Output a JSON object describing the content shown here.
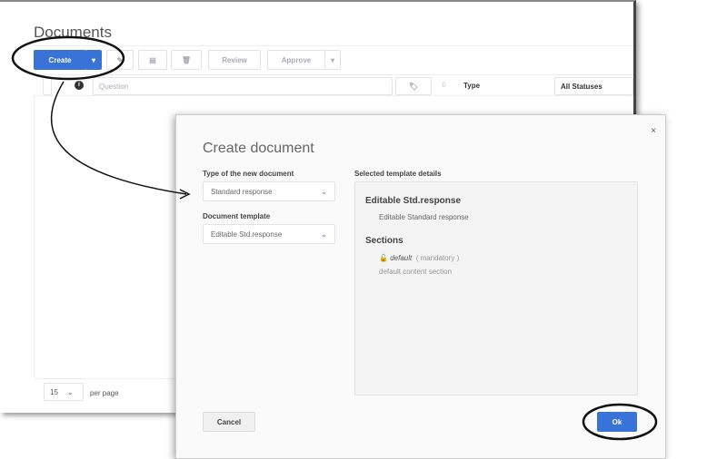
{
  "page": {
    "title": "Documents"
  },
  "toolbar": {
    "create": "Create",
    "review": "Review",
    "approve": "Approve"
  },
  "filter": {
    "question_placeholder": "Question",
    "type": "Type",
    "status": "All Statuses"
  },
  "pager": {
    "size": "15",
    "per_page": "per page"
  },
  "dialog": {
    "title": "Create document",
    "type_label": "Type of the new document",
    "type_value": "Standard response",
    "template_label": "Document template",
    "template_value": "Editable Std.response",
    "details_label": "Selected template details",
    "details_title": "Editable Std.response",
    "details_desc": "Editable Standard response",
    "sections_title": "Sections",
    "section_name": "default",
    "section_flag": "( mandatory )",
    "section_desc": "default content section",
    "cancel": "Cancel",
    "ok": "Ok",
    "close": "×"
  },
  "colors": {
    "accent": "#3a73d8"
  }
}
